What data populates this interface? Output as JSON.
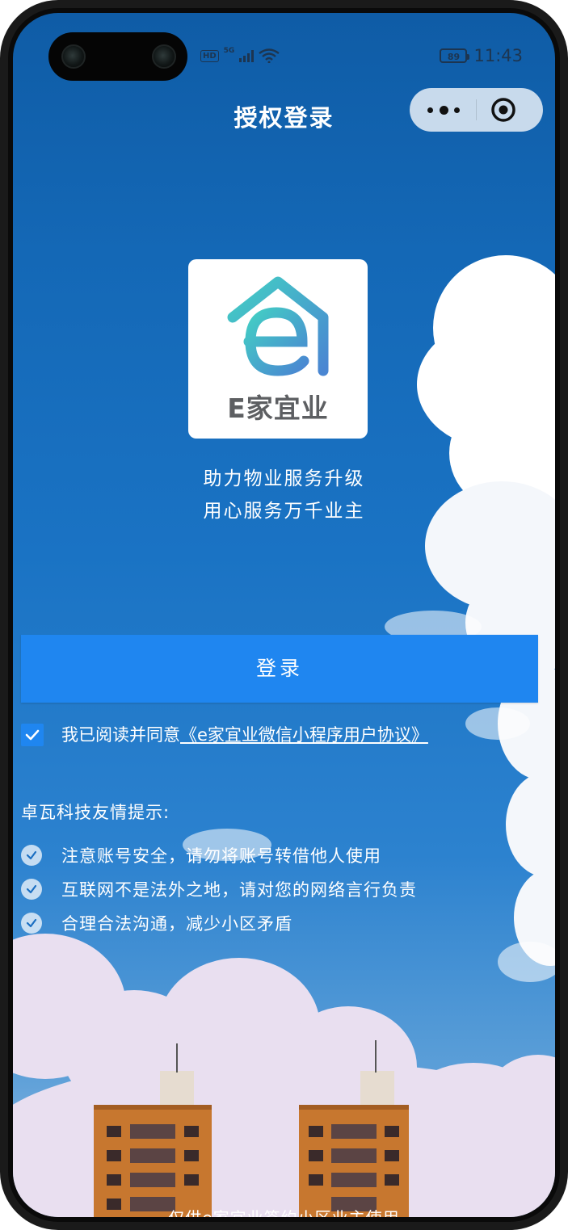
{
  "status_bar": {
    "network_badge": "HD",
    "network_type": "5G",
    "battery": "89",
    "time": "11:43"
  },
  "nav": {
    "title": "授权登录",
    "more_icon": "more-dots-icon",
    "close_icon": "target-circle-icon"
  },
  "logo": {
    "text": "E家宜业",
    "icon": "house-e-logo-icon"
  },
  "slogan": {
    "line1": "助力物业服务升级",
    "line2": "用心服务万千业主"
  },
  "login_button": {
    "label": "登录"
  },
  "agreement": {
    "checked": true,
    "prefix": "我已阅读并同意",
    "link_text": "《e家宜业微信小程序用户协议》"
  },
  "tips": {
    "title": "卓瓦科技友情提示:",
    "items": [
      "注意账号安全，请勿将账号转借他人使用",
      "互联网不是法外之地，请对您的网络言行负责",
      "合理合法沟通，减少小区矛盾"
    ]
  },
  "footer": {
    "note": "仅供e家宜业签约小区业主使用"
  },
  "colors": {
    "primary": "#1f86f0",
    "sky_top": "#0f5ca6",
    "logo_teal": "#3bc6c2",
    "logo_blue": "#4f8fd4"
  }
}
